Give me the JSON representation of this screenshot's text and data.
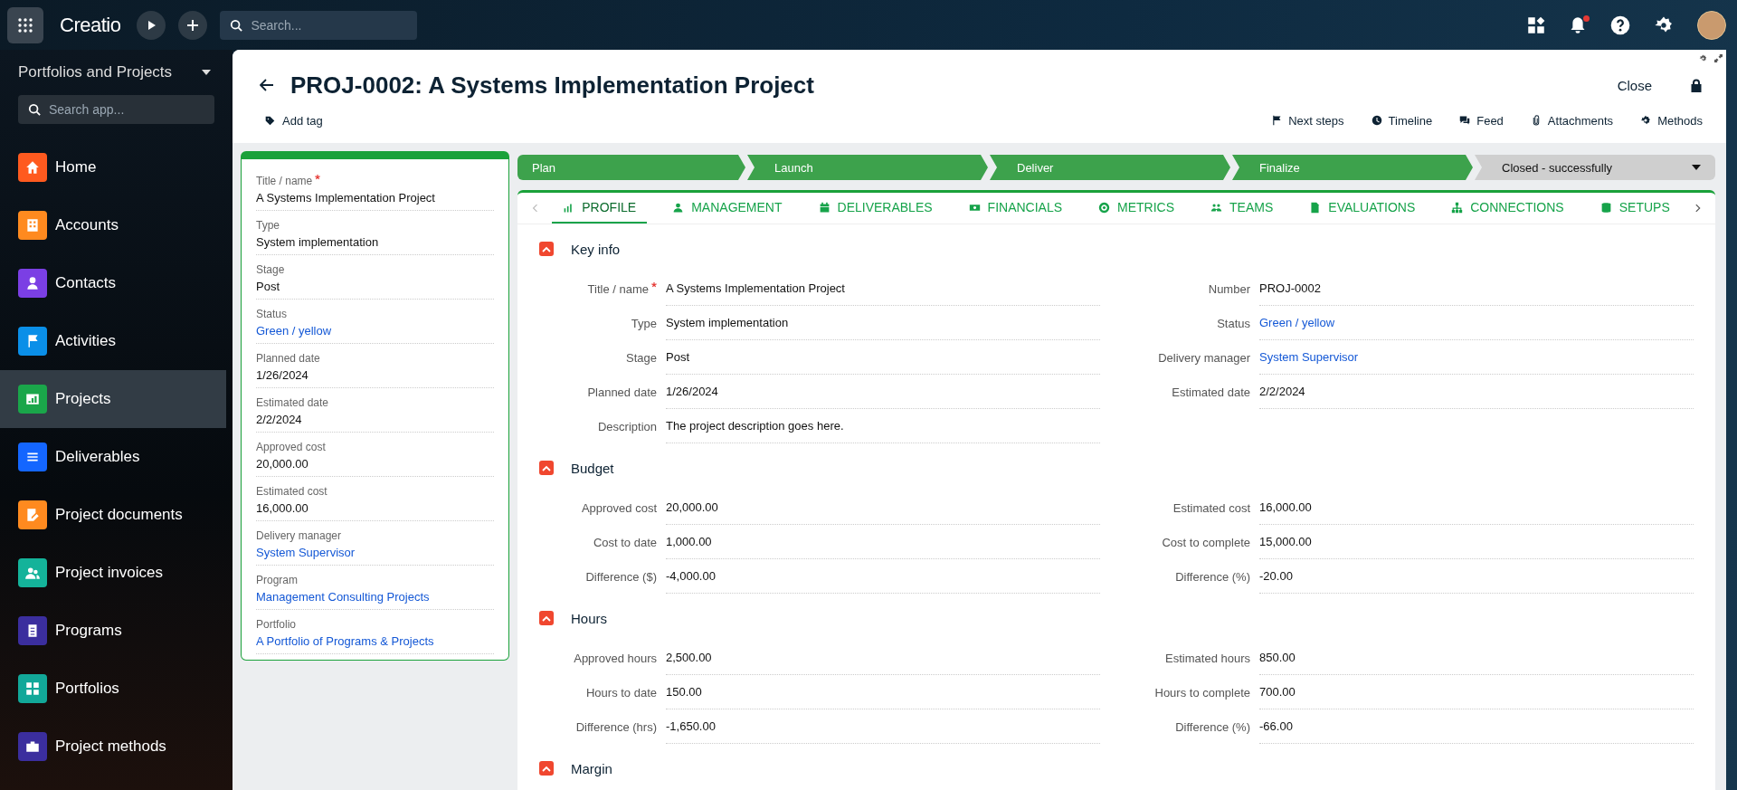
{
  "top_bar": {
    "logo": "Creatio",
    "search": {
      "placeholder": "Search..."
    },
    "notifications_unread": true
  },
  "sidebar": {
    "workspace": "Portfolios and Projects",
    "search": {
      "placeholder": "Search app..."
    },
    "items": [
      {
        "label": "Home",
        "color": "#ff5a1f",
        "selected": false
      },
      {
        "label": "Accounts",
        "color": "#ff8a1f",
        "selected": false
      },
      {
        "label": "Contacts",
        "color": "#7b3fe4",
        "selected": false
      },
      {
        "label": "Activities",
        "color": "#0a8fe8",
        "selected": false
      },
      {
        "label": "Projects",
        "color": "#1aa64a",
        "selected": true
      },
      {
        "label": "Deliverables",
        "color": "#1466ff",
        "selected": false
      },
      {
        "label": "Project documents",
        "color": "#ff8a1f",
        "selected": false
      },
      {
        "label": "Project invoices",
        "color": "#14b39a",
        "selected": false
      },
      {
        "label": "Programs",
        "color": "#3b2e9e",
        "selected": false
      },
      {
        "label": "Portfolios",
        "color": "#12a899",
        "selected": false
      },
      {
        "label": "Project methods",
        "color": "#3b2e9e",
        "selected": false
      }
    ]
  },
  "record": {
    "title": "PROJ-0002: A Systems Implementation Project",
    "add_tag": "Add tag",
    "close": "Close",
    "locked": true,
    "actions": [
      "Next steps",
      "Timeline",
      "Feed",
      "Attachments",
      "Methods"
    ]
  },
  "summary_card": {
    "fields": [
      {
        "label": "Title / name",
        "value": "A Systems Implementation Project",
        "link": false,
        "required": true
      },
      {
        "label": "Type",
        "value": "System implementation",
        "link": false,
        "required": false
      },
      {
        "label": "Stage",
        "value": "Post",
        "link": false,
        "required": false
      },
      {
        "label": "Status",
        "value": "Green / yellow",
        "link": true,
        "required": false
      },
      {
        "label": "Planned date",
        "value": "1/26/2024",
        "link": false,
        "required": false
      },
      {
        "label": "Estimated date",
        "value": "2/2/2024",
        "link": false,
        "required": false
      },
      {
        "label": "Approved cost",
        "value": "20,000.00",
        "link": false,
        "required": false
      },
      {
        "label": "Estimated cost",
        "value": "16,000.00",
        "link": false,
        "required": false
      },
      {
        "label": "Delivery manager",
        "value": "System Supervisor",
        "link": true,
        "required": false
      },
      {
        "label": "Program",
        "value": "Management Consulting Projects",
        "link": true,
        "required": false
      },
      {
        "label": "Portfolio",
        "value": "A Portfolio of Programs & Projects",
        "link": true,
        "required": false
      }
    ]
  },
  "stages": [
    {
      "label": "Plan",
      "completed": true
    },
    {
      "label": "Launch",
      "completed": true
    },
    {
      "label": "Deliver",
      "completed": true
    },
    {
      "label": "Finalize",
      "completed": true
    },
    {
      "label": "Closed - successfully",
      "completed": false
    }
  ],
  "tabs": [
    {
      "label": "PROFILE",
      "selected": true
    },
    {
      "label": "MANAGEMENT",
      "selected": false
    },
    {
      "label": "DELIVERABLES",
      "selected": false
    },
    {
      "label": "FINANCIALS",
      "selected": false
    },
    {
      "label": "METRICS",
      "selected": false
    },
    {
      "label": "TEAMS",
      "selected": false
    },
    {
      "label": "EVALUATIONS",
      "selected": false
    },
    {
      "label": "CONNECTIONS",
      "selected": false
    },
    {
      "label": "SETUPS",
      "selected": false
    }
  ],
  "sections": [
    {
      "title": "Key info",
      "expanded": true,
      "rows": [
        [
          {
            "label": "Title / name",
            "value": "A Systems Implementation Project",
            "link": false,
            "required": true
          },
          {
            "label": "Number",
            "value": "PROJ-0002",
            "link": false,
            "required": false
          }
        ],
        [
          {
            "label": "Type",
            "value": "System implementation",
            "link": false,
            "required": false
          },
          {
            "label": "Status",
            "value": "Green / yellow",
            "link": true,
            "required": false
          }
        ],
        [
          {
            "label": "Stage",
            "value": "Post",
            "link": false,
            "required": false
          },
          {
            "label": "Delivery manager",
            "value": "System Supervisor",
            "link": true,
            "required": false
          }
        ],
        [
          {
            "label": "Planned date",
            "value": "1/26/2024",
            "link": false,
            "required": false
          },
          {
            "label": "Estimated date",
            "value": "2/2/2024",
            "link": false,
            "required": false
          }
        ],
        [
          {
            "label": "Description",
            "value": "The project description goes here.",
            "link": false,
            "required": false
          }
        ]
      ]
    },
    {
      "title": "Budget",
      "expanded": true,
      "rows": [
        [
          {
            "label": "Approved cost",
            "value": "20,000.00",
            "link": false,
            "required": false
          },
          {
            "label": "Estimated cost",
            "value": "16,000.00",
            "link": false,
            "required": false
          }
        ],
        [
          {
            "label": "Cost to date",
            "value": "1,000.00",
            "link": false,
            "required": false
          },
          {
            "label": "Cost to complete",
            "value": "15,000.00",
            "link": false,
            "required": false
          }
        ],
        [
          {
            "label": "Difference ($)",
            "value": "-4,000.00",
            "link": false,
            "required": false
          },
          {
            "label": "Difference (%)",
            "value": "-20.00",
            "link": false,
            "required": false
          }
        ]
      ]
    },
    {
      "title": "Hours",
      "expanded": true,
      "rows": [
        [
          {
            "label": "Approved hours",
            "value": "2,500.00",
            "link": false,
            "required": false
          },
          {
            "label": "Estimated hours",
            "value": "850.00",
            "link": false,
            "required": false
          }
        ],
        [
          {
            "label": "Hours to date",
            "value": "150.00",
            "link": false,
            "required": false
          },
          {
            "label": "Hours to complete",
            "value": "700.00",
            "link": false,
            "required": false
          }
        ],
        [
          {
            "label": "Difference (hrs)",
            "value": "-1,650.00",
            "link": false,
            "required": false
          },
          {
            "label": "Difference (%)",
            "value": "-66.00",
            "link": false,
            "required": false
          }
        ]
      ]
    },
    {
      "title": "Margin",
      "expanded": true
    }
  ]
}
